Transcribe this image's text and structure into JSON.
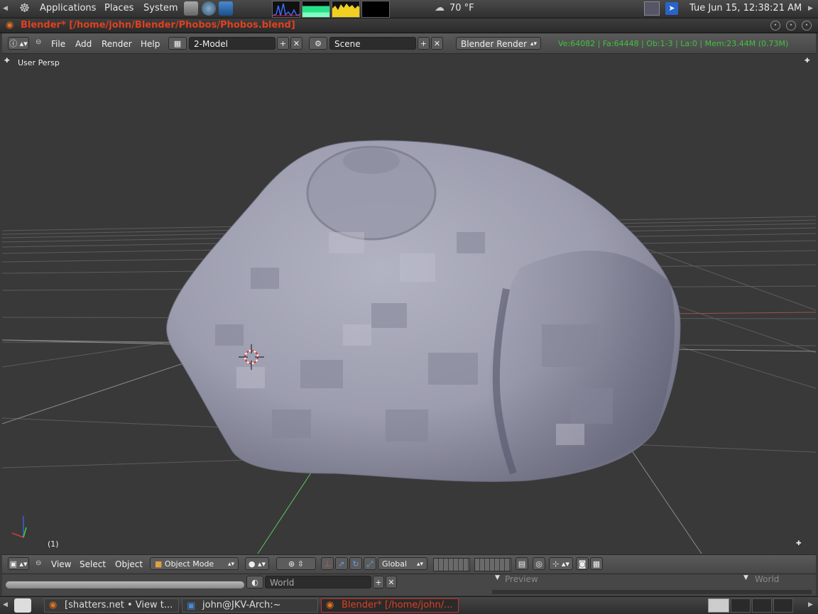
{
  "top_panel": {
    "menus": [
      "Applications",
      "Places",
      "System"
    ],
    "weather": "70 °F",
    "clock": "Tue Jun 15, 12:38:21 AM"
  },
  "window": {
    "title": "Blender* [/home/john/Blender/Phobos/Phobos.blend]"
  },
  "info_header": {
    "menus": [
      "File",
      "Add",
      "Render",
      "Help"
    ],
    "screen_layout": "2-Model",
    "scene": "Scene",
    "render_engine": "Blender Render",
    "stats": "Ve:64082 | Fa:64448 | Ob:1-3 | La:0 | Mem:23.44M (0.73M)"
  },
  "viewport": {
    "view_label": "User Persp",
    "frame_label": "(1)"
  },
  "view3d_header": {
    "menus": [
      "View",
      "Select",
      "Object"
    ],
    "mode": "Object Mode",
    "orientation": "Global"
  },
  "properties_strip": {
    "world_field": "World",
    "preview_label": "Preview",
    "world_label": "World"
  },
  "taskbar": {
    "tasks": [
      {
        "label": "[shatters.net • View t..."
      },
      {
        "label": "john@JKV-Arch:~"
      },
      {
        "label": "Blender* [/home/john/..."
      }
    ]
  },
  "colors": {
    "title_red": "#e04020",
    "stats_green": "#3fc23f",
    "viewport_bg": "#393939",
    "rock": "#a4a5b6"
  }
}
